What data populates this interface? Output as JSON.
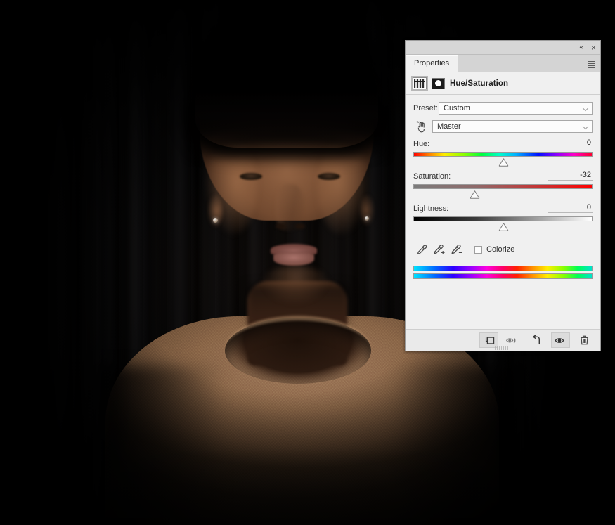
{
  "photo": {
    "description": "dark studio portrait of a man in a beige knit sweater",
    "background_color": "#000000",
    "sweater_color": "#96704f",
    "skin_color": "#7a4f33"
  },
  "panel": {
    "titlebar": {
      "collapse_icon": "double-chevron-left-icon",
      "collapse_label": "«",
      "close_icon": "close-icon",
      "close_label": "×"
    },
    "tabs": [
      {
        "label": "Properties",
        "active": true
      }
    ],
    "menu_icon": "panel-menu-icon",
    "adjustment": {
      "layer_thumbnail_icon": "adjustment-layer-thumbnail",
      "mask_thumbnail_icon": "layer-mask-thumbnail",
      "title": "Hue/Saturation"
    },
    "preset": {
      "label": "Preset:",
      "value": "Custom",
      "chevron_icon": "chevron-down-icon"
    },
    "channel": {
      "on_image_tool_icon": "on-image-adjustment-hand-icon",
      "value": "Master",
      "chevron_icon": "chevron-down-icon"
    },
    "sliders": [
      {
        "name": "hue",
        "label": "Hue:",
        "value": "0",
        "position_pct": 50.0,
        "track_type": "hue-spectrum"
      },
      {
        "name": "saturation",
        "label": "Saturation:",
        "value": "-32",
        "position_pct": 34.0,
        "track_type": "gray-to-red"
      },
      {
        "name": "lightness",
        "label": "Lightness:",
        "value": "0",
        "position_pct": 50.0,
        "track_type": "black-to-white"
      }
    ],
    "eyedroppers": [
      {
        "name": "sample-color",
        "icon": "eyedropper-icon"
      },
      {
        "name": "add-to-sample",
        "icon": "eyedropper-plus-icon"
      },
      {
        "name": "subtract-from-sample",
        "icon": "eyedropper-minus-icon"
      }
    ],
    "colorize": {
      "label": "Colorize",
      "checked": false
    },
    "color_bars": {
      "count": 2,
      "description": "hue range reference bars"
    },
    "footer_buttons": [
      {
        "name": "clip-to-layer",
        "icon": "clip-to-layer-icon",
        "active": true
      },
      {
        "name": "toggle-mask-view",
        "icon": "mask-view-icon",
        "active": false
      },
      {
        "name": "reset",
        "icon": "reset-arrow-icon",
        "active": false
      },
      {
        "name": "toggle-visibility",
        "icon": "eye-icon",
        "active": true
      },
      {
        "name": "delete-layer",
        "icon": "trash-icon",
        "active": false
      }
    ],
    "resize_grip_icon": "resize-grip-icon"
  },
  "colors": {
    "panel_bg": "#f0f0f0",
    "panel_border": "#9c9c9c",
    "tab_bar": "#d4d4d4",
    "footer_bg": "#eaeaea",
    "text": "#2b2b2b",
    "saturation_track_end": "#ff0000"
  }
}
